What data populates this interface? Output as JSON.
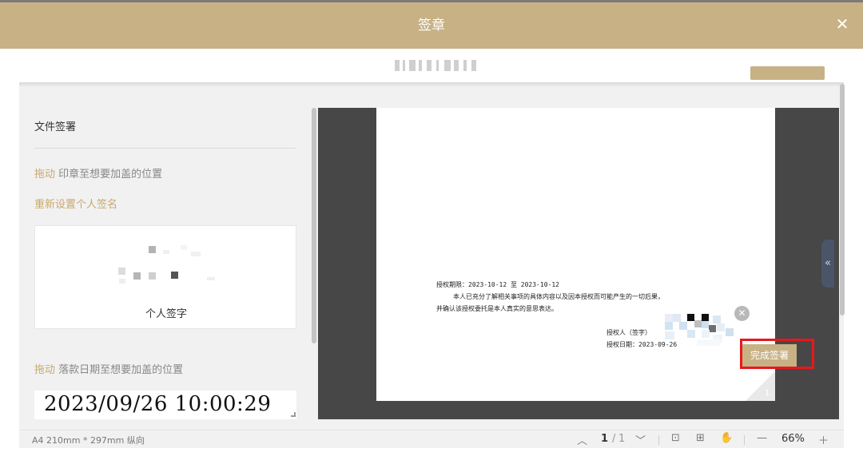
{
  "dialog": {
    "title": "签章",
    "close_icon": "close-icon"
  },
  "left": {
    "section_title": "文件签署",
    "drag_seal_verb": "拖动",
    "drag_seal_text": " 印章至想要加盖的位置",
    "reset_signature": "重新设置个人签名",
    "signature_label": "个人签字",
    "drag_date_verb": "拖动",
    "drag_date_text": " 落款日期至想要加盖的位置",
    "date_value": "2023/09/26 10:00:29"
  },
  "document": {
    "line1": "授权期限：2023-10-12  至 2023-10-12",
    "line2": "本人已充分了解相关事项的具体内容以及因本授权而可能产生的一切后果，",
    "line3": "并确认该授权委托是本人真实的意思表达。",
    "line4": "授权人（签字）",
    "line5": "授权日期：2023-09-26",
    "page_corner_number": "1"
  },
  "signature_overlay": {
    "delete_icon": "close-circle-icon",
    "finish_button": "完成签署"
  },
  "footer": {
    "paper_info": "A4 210mm * 297mm 纵向",
    "current_page": "1",
    "page_separator": "/",
    "total_pages": "1",
    "zoom": "66%"
  },
  "colors": {
    "accent": "#c8b185",
    "link": "#c8a96e",
    "highlight": "#e5191e",
    "viewer_bg": "#474747"
  }
}
